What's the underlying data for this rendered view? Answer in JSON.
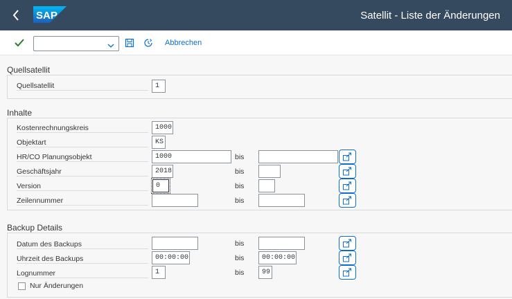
{
  "shell": {
    "title": "Satellit - Liste der Änderungen",
    "logo_text": "SAP",
    "brand_color": "#354a5f"
  },
  "toolbar": {
    "command_value": "",
    "cancel_label": "Abbrechen"
  },
  "sections": {
    "quellsatellit": {
      "title": "Quellsatellit",
      "rows": [
        {
          "label": "Quellsatellit",
          "from": "1"
        }
      ]
    },
    "inhalte": {
      "title": "Inhalte",
      "rows": [
        {
          "label": "Kostenrechnungskreis",
          "from": "1000"
        },
        {
          "label": "Objektart",
          "from": "KS"
        },
        {
          "label": "HR/CO Planungsobjekt",
          "from": "1000",
          "bis": "bis",
          "to": ""
        },
        {
          "label": "Geschäftsjahr",
          "from": "2018",
          "bis": "bis",
          "to": ""
        },
        {
          "label": "Version",
          "from": "0",
          "bis": "bis",
          "to": ""
        },
        {
          "label": "Zeilennummer",
          "from": "",
          "bis": "bis",
          "to": ""
        }
      ]
    },
    "backup": {
      "title": "Backup Details",
      "rows": [
        {
          "label": "Datum des Backups",
          "from": "",
          "bis": "bis",
          "to": ""
        },
        {
          "label": "Uhrzeit des Backups",
          "from": "00:00:00",
          "bis": "bis",
          "to": "00:00:00"
        },
        {
          "label": "Lognummer",
          "from": "1",
          "bis": "bis",
          "to": "99"
        }
      ],
      "checkbox_label": "Nur Änderungen",
      "checkbox_checked": false
    }
  }
}
